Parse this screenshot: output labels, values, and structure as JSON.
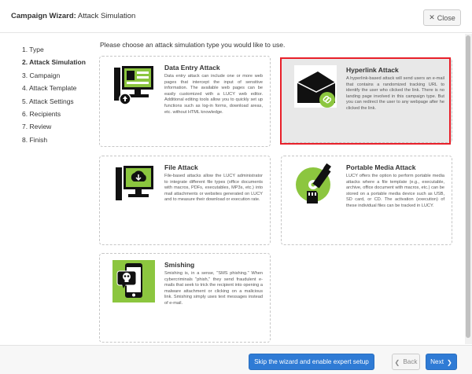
{
  "header": {
    "title_bold": "Campaign Wizard:",
    "title_rest": " Attack Simulation",
    "close_label": "Close",
    "close_icon": "close-icon"
  },
  "steps": [
    {
      "label": "1. Type",
      "active": false
    },
    {
      "label": "2. Attack Simulation",
      "active": true
    },
    {
      "label": "3. Campaign",
      "active": false
    },
    {
      "label": "4. Attack Template",
      "active": false
    },
    {
      "label": "5. Attack Settings",
      "active": false
    },
    {
      "label": "6. Recipients",
      "active": false
    },
    {
      "label": "7. Review",
      "active": false
    },
    {
      "label": "8. Finish",
      "active": false
    }
  ],
  "prompt": "Please choose an attack simulation type you would like to use.",
  "cards": [
    {
      "title": "Data Entry Attack",
      "description": "Data entry attack can include one or more web pages that intercept the input of sensitive information. The available web pages can be easily customized with a LUCY web editor. Additional editing tools allow you to quickly set up functions such as log-in forms, download areas, etc. without HTML knowledge.",
      "icon": "data-entry-computer-icon",
      "selected": false
    },
    {
      "title": "Hyperlink Attack",
      "description": "A hyperlink-based attack will send users an e-mail that contains a randomized tracking URL to identify the user who clicked the link. There is no landing page involved in this campaign type. But you can redirect the user to any webpage after he clicked the link.",
      "icon": "envelope-link-icon",
      "selected": true
    },
    {
      "title": "File Attack",
      "description": "File-based attacks allow the LUCY administrator to integrate different file types (office documents with macros, PDFs, executables, MP3s, etc.) into mail attachments or websites generated on LUCY and to measure their download or execution rate.",
      "icon": "file-download-computer-icon",
      "selected": false
    },
    {
      "title": "Portable Media Attack",
      "description": "LUCY offers the option to perform portable media attacks where a file template (e.g., executable, archive, office document with macros, etc.) can be stored on a portable media device such as USB, SD card, or CD. The activation (execution) of these individual files can be tracked in LUCY.",
      "icon": "usb-sd-cd-icon",
      "selected": false
    },
    {
      "title": "Smishing",
      "description": "Smishing is, in a sense, \"SMS phishing.\" When cybercriminals \"phish,\" they send fraudulent e-mails that seek to trick the recipient into opening a malware attachment or clicking on a malicious link. Smishing simply uses text messages instead of e-mail.",
      "icon": "phone-skull-icon",
      "selected": false
    }
  ],
  "footer": {
    "skip_label": "Skip the wizard and enable expert setup",
    "back_label": "Back",
    "next_label": "Next"
  },
  "colors": {
    "accent": "#2f7bd5",
    "icon_green": "#8cc63f",
    "selection_border": "#e8202a"
  }
}
